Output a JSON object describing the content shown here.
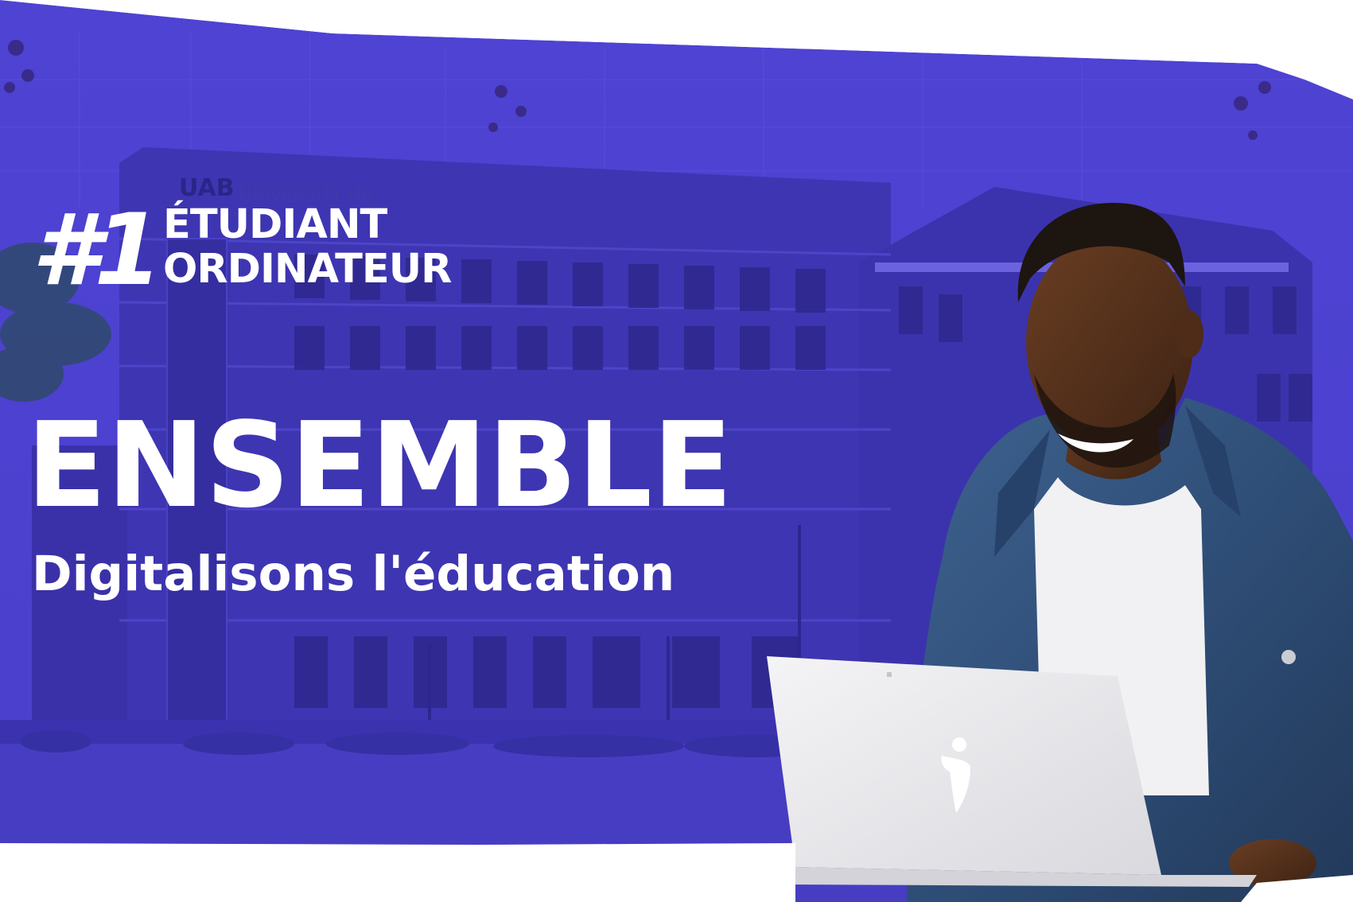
{
  "banner": {
    "rank": "#1",
    "rank_line1": "ÉTUDIANT",
    "rank_line2": "ORDINATEUR",
    "headline": "ENSEMBLE",
    "subline": "Digitalisons l'éducation",
    "building_sign_logo": "UAB",
    "building_sign_text": "UNIVERSITY HA"
  },
  "colors": {
    "overlay": "#4b3fd0",
    "text": "#ffffff",
    "jacket": "#34557e",
    "laptop": "#ebebee"
  },
  "icons": {
    "laptop_logo": "figure-logo-icon"
  }
}
